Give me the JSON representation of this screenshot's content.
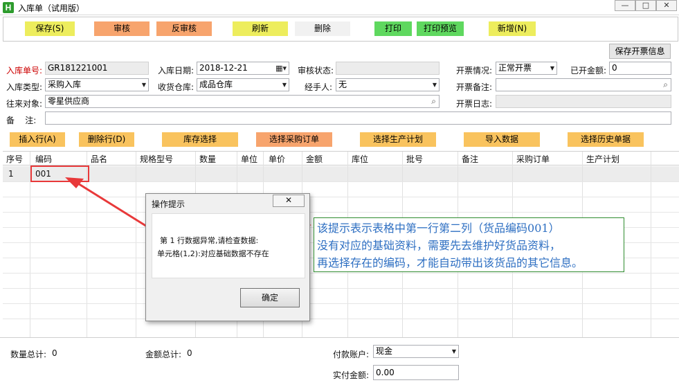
{
  "window": {
    "logo_letter": "H",
    "title": "入库单（试用版）",
    "minimize_glyph": "—",
    "restore_glyph": "□",
    "close_glyph": "✕"
  },
  "toolbar": {
    "save": "保存(S)",
    "audit": "审核",
    "unaudit": "反审核",
    "refresh": "刷新",
    "delete": "删除",
    "print": "打印",
    "print_preview": "打印预览",
    "new": "新增(N)"
  },
  "invoice_save_button": "保存开票信息",
  "form": {
    "doc_no_label": "入库单号:",
    "doc_no_value": "GR181221001",
    "in_date_label": "入库日期:",
    "in_date_value": "2018-12-21",
    "audit_status_label": "审核状态:",
    "audit_status_value": "",
    "invoice_status_label": "开票情况:",
    "invoice_status_value": "正常开票",
    "invoiced_amount_label": "已开金额:",
    "invoiced_amount_value": "0",
    "in_type_label": "入库类型:",
    "in_type_value": "采购入库",
    "warehouse_label": "收货仓库:",
    "warehouse_value": "成品仓库",
    "handler_label": "经手人:",
    "handler_value": "无",
    "invoice_note_label": "开票备注:",
    "invoice_note_value": "",
    "partner_label": "往来对象:",
    "partner_value": "零星供应商",
    "invoice_date_label": "开票日志:",
    "invoice_date_value": "",
    "remark_label": "备    注:",
    "remark_value": ""
  },
  "actions": {
    "insert_row": "插入行(A)",
    "delete_row": "删除行(D)",
    "stock_select": "库存选择",
    "select_po": "选择采购订单",
    "select_plan": "选择生产计划",
    "import_data": "导入数据",
    "select_history": "选择历史单据"
  },
  "grid": {
    "columns": [
      "序号",
      "编码",
      "品名",
      "规格型号",
      "数量",
      "单位",
      "单价",
      "金额",
      "库位",
      "批号",
      "备注",
      "采购订单",
      "生产计划"
    ],
    "rows": [
      {
        "seq": "1",
        "code": "001"
      }
    ]
  },
  "dialog": {
    "title": "操作提示",
    "close_label": "✕",
    "message_line1": "第 1 行数据异常,请检查数据:",
    "message_line2": "单元格(1,2):对应基础数据不存在",
    "ok_label": "确定"
  },
  "note": {
    "line1_pre": "该提示表示表格中",
    "line1_mid": "第一行第二列",
    "line1_post": "（货品编码001）",
    "line2": "没有对应的基础资料，需要先去维护好货品资料，",
    "line3": "再选择存在的编码，才能自动带出该货品的其它信息。"
  },
  "footer": {
    "qty_total_label": "数量总计:",
    "qty_total_value": "0",
    "amount_total_label": "金额总计:",
    "amount_total_value": "0",
    "pay_account_label": "付款账户:",
    "pay_account_value": "现金",
    "paid_amount_label": "实付金额:",
    "paid_amount_value": "0.00"
  },
  "colors": {
    "annotation_red": "#e8393a",
    "note_blue": "#2e6fc2",
    "note_border": "#2e8b2e"
  }
}
